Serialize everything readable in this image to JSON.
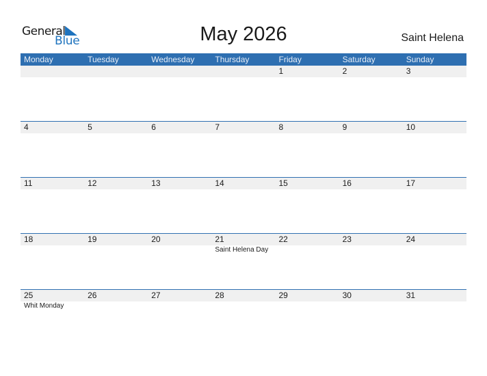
{
  "logo": {
    "line1": "General",
    "line2": "Blue"
  },
  "title": "May 2026",
  "country": "Saint Helena",
  "colors": {
    "header": "#2e6fb1",
    "strip": "#f0f0f0"
  },
  "weekdays": [
    "Monday",
    "Tuesday",
    "Wednesday",
    "Thursday",
    "Friday",
    "Saturday",
    "Sunday"
  ],
  "weeks": [
    {
      "days": [
        "",
        "",
        "",
        "",
        "1",
        "2",
        "3"
      ],
      "events": [
        "",
        "",
        "",
        "",
        "",
        "",
        ""
      ]
    },
    {
      "days": [
        "4",
        "5",
        "6",
        "7",
        "8",
        "9",
        "10"
      ],
      "events": [
        "",
        "",
        "",
        "",
        "",
        "",
        ""
      ]
    },
    {
      "days": [
        "11",
        "12",
        "13",
        "14",
        "15",
        "16",
        "17"
      ],
      "events": [
        "",
        "",
        "",
        "",
        "",
        "",
        ""
      ]
    },
    {
      "days": [
        "18",
        "19",
        "20",
        "21",
        "22",
        "23",
        "24"
      ],
      "events": [
        "",
        "",
        "",
        "Saint Helena Day",
        "",
        "",
        ""
      ]
    },
    {
      "days": [
        "25",
        "26",
        "27",
        "28",
        "29",
        "30",
        "31"
      ],
      "events": [
        "Whit Monday",
        "",
        "",
        "",
        "",
        "",
        ""
      ]
    }
  ]
}
